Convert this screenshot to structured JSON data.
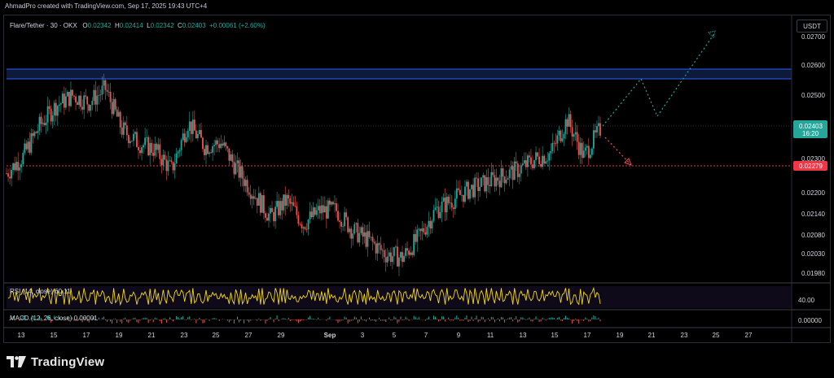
{
  "header": {
    "credit": "AhmadPro created with TradingView.com, Sep 17, 2025 19:43 UTC+4"
  },
  "legend": {
    "symbol": "Flare/Tether · 30 · OKX",
    "o_label": "O",
    "o_value": "0.02342",
    "h_label": "H",
    "h_value": "0.02414",
    "l_label": "L",
    "l_value": "0.02342",
    "c_label": "C",
    "c_value": "0.02403",
    "change": "+0.00061 (+2.60%)"
  },
  "currency_button": "USDT",
  "colors": {
    "up": "#26a69a",
    "down": "#ef5350",
    "zone": "#0d1a3a",
    "zone_line": "#2962ff",
    "support": "#f23645",
    "projection": "#26a69a",
    "rsi": "#f5d90a",
    "background": "#000000"
  },
  "price_axis": {
    "ticks": [
      "0.02700",
      "0.02600",
      "0.02500",
      "0.02300",
      "0.02200",
      "0.02140",
      "0.02080",
      "0.02030",
      "0.01980"
    ],
    "current_price": "0.02403",
    "countdown": "16:20",
    "support_price": "0.02279"
  },
  "rsi_pane": {
    "label": "RSI (14, close) 60.11",
    "tick": "40.00"
  },
  "macd_pane": {
    "label": "MACD (12, 26, close) 0.00001",
    "tick": "0.00000"
  },
  "time_axis": {
    "ticks": [
      "13",
      "15",
      "17",
      "19",
      "21",
      "23",
      "25",
      "27",
      "29",
      "Sep",
      "3",
      "5",
      "7",
      "9",
      "11",
      "13",
      "15",
      "17",
      "19",
      "21",
      "23",
      "25",
      "27"
    ]
  },
  "footer": {
    "brand": "TradingView"
  },
  "chart_data": {
    "type": "candlestick",
    "title": "Flare/Tether · 30 · OKX",
    "ylim": [
      0.0195,
      0.0273
    ],
    "approx_close_path": [
      [
        "Aug 12",
        0.0227
      ],
      [
        "Aug 13",
        0.0232
      ],
      [
        "Aug 14",
        0.0241
      ],
      [
        "Aug 15",
        0.0247
      ],
      [
        "Aug 16",
        0.025
      ],
      [
        "Aug 17",
        0.0248
      ],
      [
        "Aug 18",
        0.0252
      ],
      [
        "Aug 19",
        0.024
      ],
      [
        "Aug 20",
        0.0236
      ],
      [
        "Aug 21",
        0.0234
      ],
      [
        "Aug 22",
        0.0228
      ],
      [
        "Aug 23",
        0.0242
      ],
      [
        "Aug 24",
        0.0235
      ],
      [
        "Aug 25",
        0.0236
      ],
      [
        "Aug 26",
        0.0228
      ],
      [
        "Aug 27",
        0.0221
      ],
      [
        "Aug 28",
        0.0214
      ],
      [
        "Aug 29",
        0.0219
      ],
      [
        "Aug 30",
        0.0212
      ],
      [
        "Aug 31",
        0.0216
      ],
      [
        "Sep 1",
        0.0216
      ],
      [
        "Sep 2",
        0.021
      ],
      [
        "Sep 3",
        0.0207
      ],
      [
        "Sep 4",
        0.0203
      ],
      [
        "Sep 5",
        0.0202
      ],
      [
        "Sep 6",
        0.0208
      ],
      [
        "Sep 7",
        0.0216
      ],
      [
        "Sep 8",
        0.0219
      ],
      [
        "Sep 9",
        0.0222
      ],
      [
        "Sep 10",
        0.0224
      ],
      [
        "Sep 11",
        0.0226
      ],
      [
        "Sep 12",
        0.0228
      ],
      [
        "Sep 13",
        0.0231
      ],
      [
        "Sep 14",
        0.0233
      ],
      [
        "Sep 15",
        0.0243
      ],
      [
        "Sep 16",
        0.0232
      ],
      [
        "Sep 17",
        0.024
      ]
    ],
    "resistance_zone": [
      0.02555,
      0.02585
    ],
    "support_level": 0.02279,
    "projection": [
      [
        "Sep 17",
        0.024
      ],
      [
        "Sep 19.5",
        0.0256
      ],
      [
        "Sep 21",
        0.0244
      ],
      [
        "Sep 25",
        0.0271
      ]
    ],
    "alt_projection": [
      [
        "Sep 17",
        0.024
      ],
      [
        "Sep 18.5",
        0.0228
      ]
    ]
  }
}
